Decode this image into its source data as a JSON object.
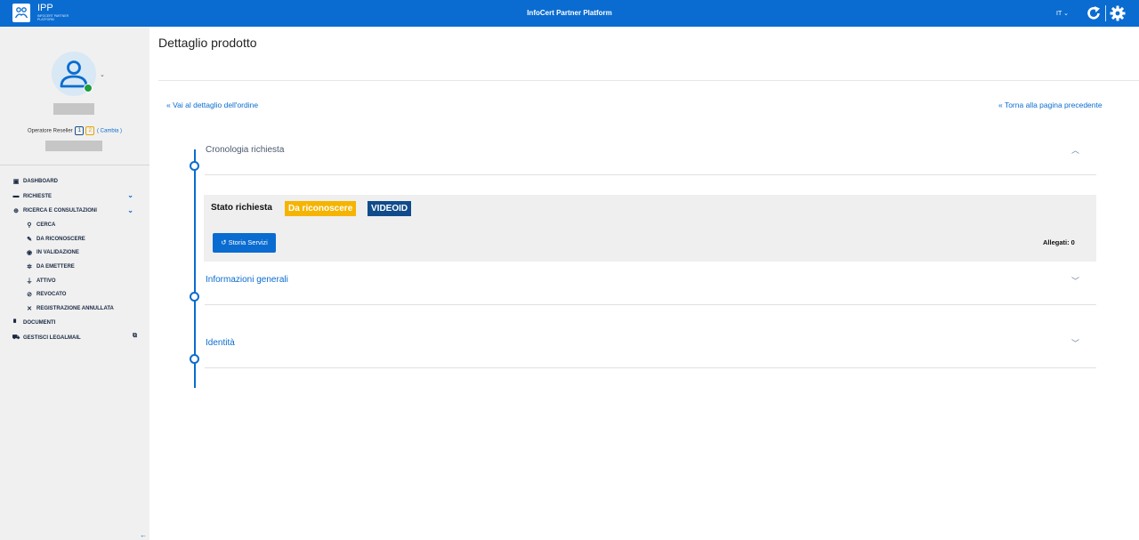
{
  "header": {
    "logo_title": "IPP",
    "logo_subtitle": "INFOCERT PARTNER PLATFORM",
    "app_title": "InfoCert Partner Platform",
    "language": "IT",
    "accent_color": "#0a6cd0"
  },
  "user": {
    "role_label": "Operatore Reseller",
    "badge1": "1",
    "badge2": "2",
    "change_label": "( Cambia )",
    "status_color": "#1e9c3f"
  },
  "sidebar": {
    "items": [
      {
        "label": "DASHBOARD",
        "icon": "dashboard-icon"
      },
      {
        "label": "RICHIESTE",
        "icon": "briefcase-icon"
      },
      {
        "label": "RICERCA E CONSULTAZIONI",
        "icon": "search-plus-icon"
      },
      {
        "label": "CERCA",
        "icon": "search-icon"
      },
      {
        "label": "DA RICONOSCERE",
        "icon": "pen-icon"
      },
      {
        "label": "IN VALIDAZIONE",
        "icon": "eye-icon"
      },
      {
        "label": "DA EMETTERE",
        "icon": "spinner-icon"
      },
      {
        "label": "ATTIVO",
        "icon": "plug-icon"
      },
      {
        "label": "REVOCATO",
        "icon": "ban-icon"
      },
      {
        "label": "REGISTRAZIONE ANNULLATA",
        "icon": "close-icon"
      },
      {
        "label": "DOCUMENTI",
        "icon": "document-icon"
      },
      {
        "label": "GESTISCI LEGALMAIL",
        "icon": "mail-truck-icon"
      }
    ]
  },
  "main": {
    "page_title": "Dettaglio prodotto",
    "link_order": "Vai al dettaglio dell'ordine",
    "link_back": "Torna alla pagina precedente",
    "sections": [
      {
        "title": "Cronologia richiesta",
        "expanded": true
      },
      {
        "title": "Informazioni generali",
        "expanded": false
      },
      {
        "title": "Identità",
        "expanded": false
      }
    ],
    "stato": {
      "label": "Stato richiesta",
      "status_tag": "Da riconoscere",
      "status_color": "#f5b400",
      "type_tag": "VIDEOID",
      "type_color": "#104c8c",
      "history_button": "Storia Servizi",
      "attachments": "Allegati: 0"
    }
  }
}
